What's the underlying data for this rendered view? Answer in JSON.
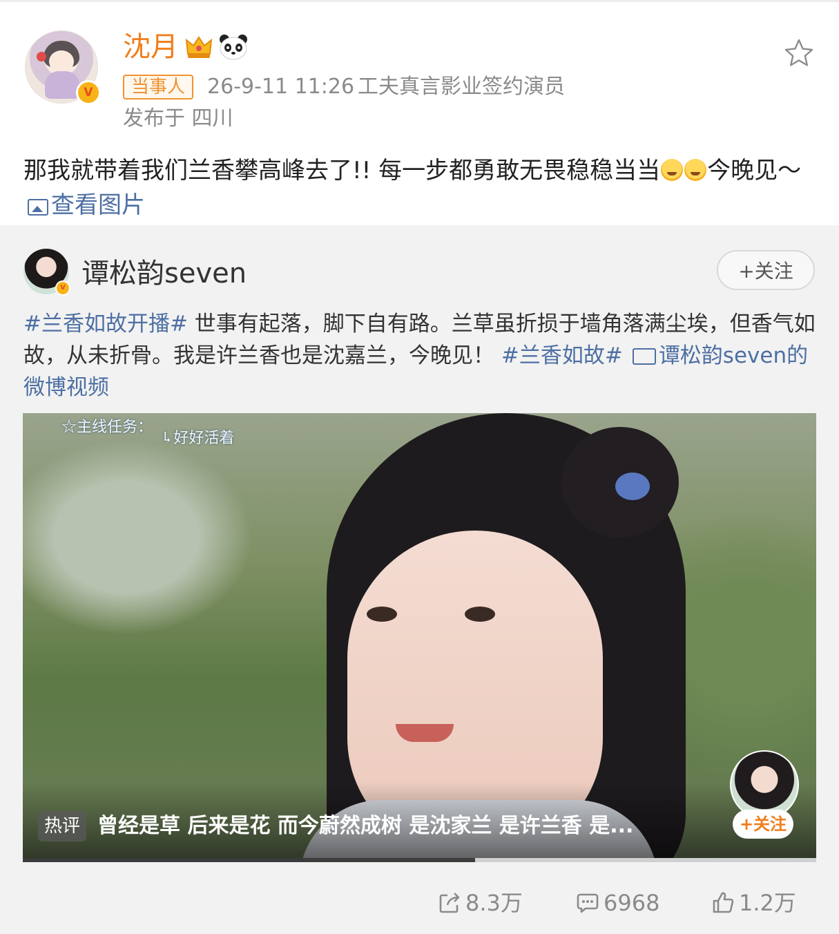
{
  "post": {
    "author": {
      "name": "沈月",
      "verified": true,
      "badges": [
        "crown-icon",
        "panda-icon"
      ]
    },
    "role_tag": "当事人",
    "time": "26-9-11 11:26",
    "source": "工夫真言影业签约演员",
    "location": "发布于 四川",
    "text_part1": "那我就带着我们兰香攀高峰去了!! 每一步都勇敢无畏稳稳当当",
    "text_part2": "今晚见～",
    "view_picture_label": "查看图片"
  },
  "repost": {
    "author_name": "谭松韵seven",
    "follow_label": "+关注",
    "hashtag1": "#兰香如故开播#",
    "text1": " 世事有起落，脚下自有路。兰草虽折损于墙角落满尘埃，但香气如故，从未折骨。我是许兰香也是沈嘉兰，今晚见！ ",
    "hashtag2": "#兰香如故#",
    "video_link": "谭松韵seven的微博视频",
    "video": {
      "overlay_caption_1": "☆主线任务：",
      "overlay_caption_2": "↳好好活着",
      "hot_comment_tag": "热评",
      "hot_comment": "曾经是草 后来是花 而今蔚然成树 是沈家兰 是许兰香 是...",
      "follow_label": "+关注",
      "progress": 0.57
    }
  },
  "actions": {
    "reposts": "8.3万",
    "comments": "6968",
    "likes": "1.2万"
  },
  "colors": {
    "author_name": "#f07d1a",
    "link": "#4d6fa3",
    "secondary_text": "#8a8a8a"
  }
}
